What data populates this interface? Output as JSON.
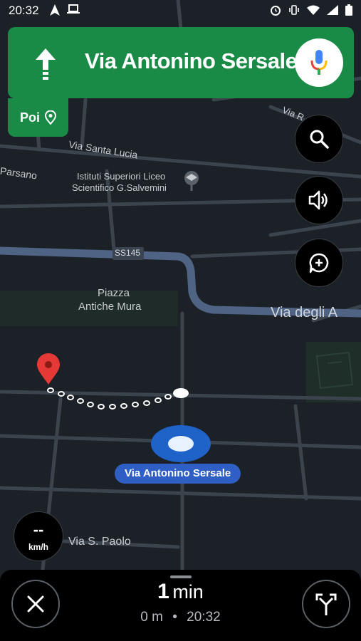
{
  "status_bar": {
    "time": "20:32"
  },
  "navigation": {
    "street": "Via Antonino Sersale",
    "poi_label": "Poi"
  },
  "map_labels": {
    "via_santa_lucia": "Via Santa Lucia",
    "parsano": "Parsano",
    "school_line1": "Istituti Superiori Liceo",
    "school_line2": "Scientifico G.Salvemini",
    "ss145": "SS145",
    "piazza_line1": "Piazza",
    "piazza_line2": "Antiche Mura",
    "via_degli": "Via degli A",
    "via_r": "Via R",
    "via_s_paolo": "Via S. Paolo",
    "current_road": "Via Antonino Sersale"
  },
  "speed": {
    "value": "--",
    "unit": "km/h"
  },
  "trip": {
    "duration_value": "1",
    "duration_unit": "min",
    "distance": "0 m",
    "separator": "•",
    "arrival": "20:32"
  },
  "colors": {
    "banner": "#1a8b47",
    "map_bg": "#1c2128",
    "route_chip": "#2f5fc4",
    "pin": "#e53935"
  }
}
